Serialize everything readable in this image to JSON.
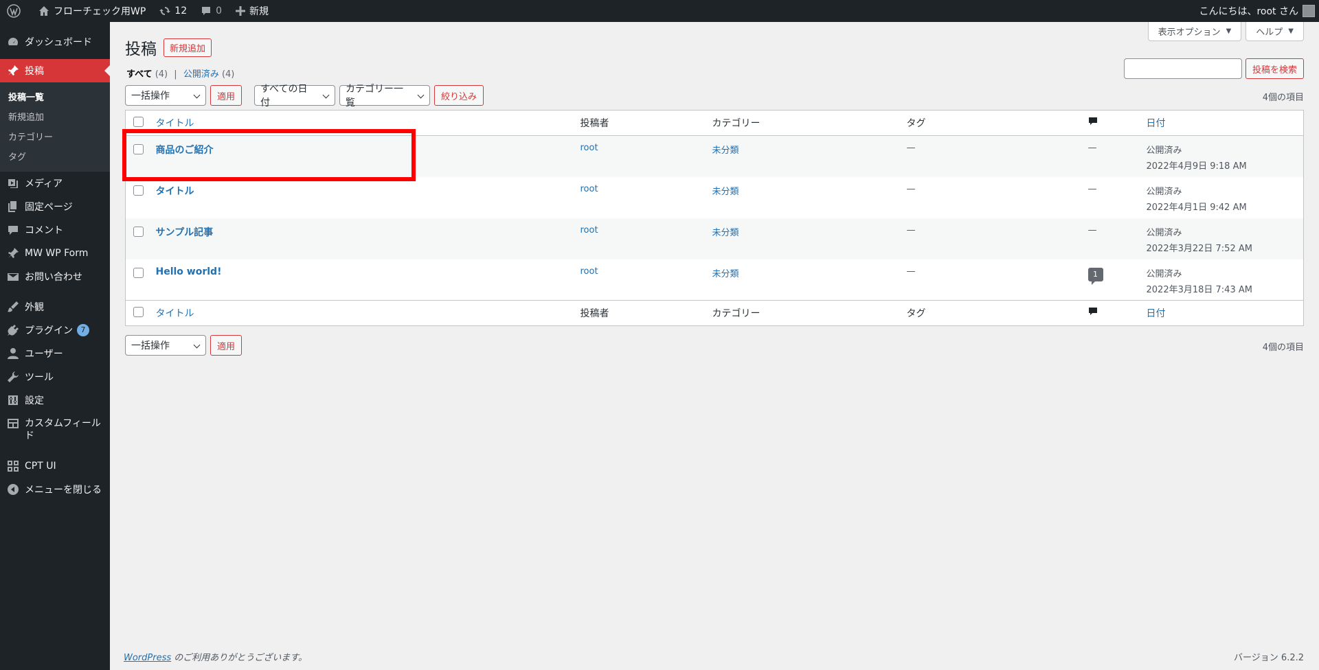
{
  "adminbar": {
    "site_name": "フローチェック用WP",
    "updates_count": "12",
    "comments_count": "0",
    "new_label": "新規",
    "greeting": "こんにちは、root さん"
  },
  "sidebar": {
    "dashboard": "ダッシュボード",
    "posts": "投稿",
    "posts_sub": [
      "投稿一覧",
      "新規追加",
      "カテゴリー",
      "タグ"
    ],
    "media": "メディア",
    "pages": "固定ページ",
    "comments": "コメント",
    "mwwpform": "MW WP Form",
    "contact": "お問い合わせ",
    "appearance": "外観",
    "plugins": "プラグイン",
    "plugins_badge": "7",
    "users": "ユーザー",
    "tools": "ツール",
    "settings": "設定",
    "custom_fields": "カスタムフィールド",
    "cptui": "CPT UI",
    "collapse": "メニューを閉じる"
  },
  "main": {
    "screen_options": "表示オプション",
    "help": "ヘルプ",
    "title": "投稿",
    "add_new": "新規追加",
    "filter_all": "すべて",
    "filter_all_count": "(4)",
    "filter_published": "公開済み",
    "filter_published_count": "(4)",
    "search_button": "投稿を検索",
    "bulk_action": "一括操作",
    "apply": "適用",
    "all_dates": "すべての日付",
    "category_list": "カテゴリー一覧",
    "filter_button": "絞り込み",
    "items_count": "4個の項目"
  },
  "table": {
    "headers": {
      "title": "タイトル",
      "author": "投稿者",
      "categories": "カテゴリー",
      "tags": "タグ",
      "date": "日付"
    },
    "rows": [
      {
        "title": "商品のご紹介",
        "author": "root",
        "category": "未分類",
        "tags": "—",
        "comments": "—",
        "status": "公開済み",
        "date": "2022年4月9日 9:18 AM"
      },
      {
        "title": "タイトル",
        "author": "root",
        "category": "未分類",
        "tags": "—",
        "comments": "—",
        "status": "公開済み",
        "date": "2022年4月1日 9:42 AM"
      },
      {
        "title": "サンプル記事",
        "author": "root",
        "category": "未分類",
        "tags": "—",
        "comments": "—",
        "status": "公開済み",
        "date": "2022年3月22日 7:52 AM"
      },
      {
        "title": "Hello world!",
        "author": "root",
        "category": "未分類",
        "tags": "—",
        "comments": "1",
        "status": "公開済み",
        "date": "2022年3月18日 7:43 AM"
      }
    ]
  },
  "footer": {
    "wp_link": "WordPress",
    "thanks": " のご利用ありがとうございます。",
    "version": "バージョン 6.2.2"
  }
}
